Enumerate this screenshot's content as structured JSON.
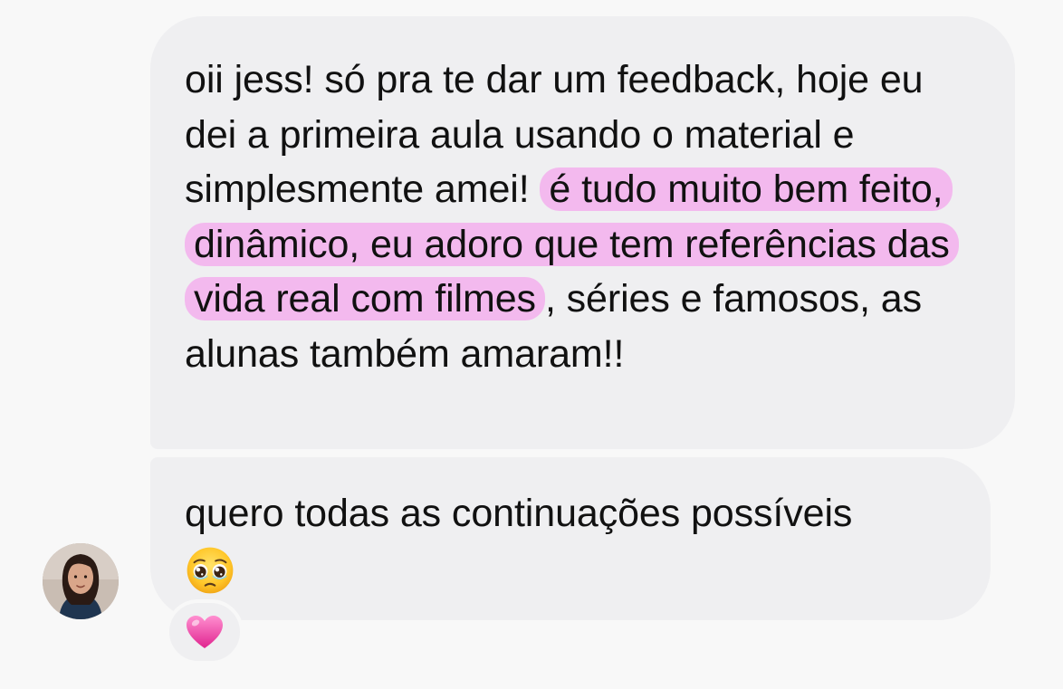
{
  "messages": [
    {
      "text_before": "oii jess! só pra te dar um feedback, hoje eu dei a primeira aula usando o material e simplesmente amei! ",
      "highlighted": "é tudo muito bem feito, dinâmico, eu adoro que tem referências das vida real com filmes",
      "text_after": ", séries e famosos, as alunas também amaram!!"
    },
    {
      "text": "quero todas as continuações possíveis",
      "emoji": "pleading-face-emoji"
    }
  ],
  "reaction": {
    "emoji": "pink-heart-emoji"
  },
  "colors": {
    "background": "#f8f8f8",
    "bubble": "#efeff1",
    "highlight": "#f3b9ee",
    "text": "#111111"
  }
}
